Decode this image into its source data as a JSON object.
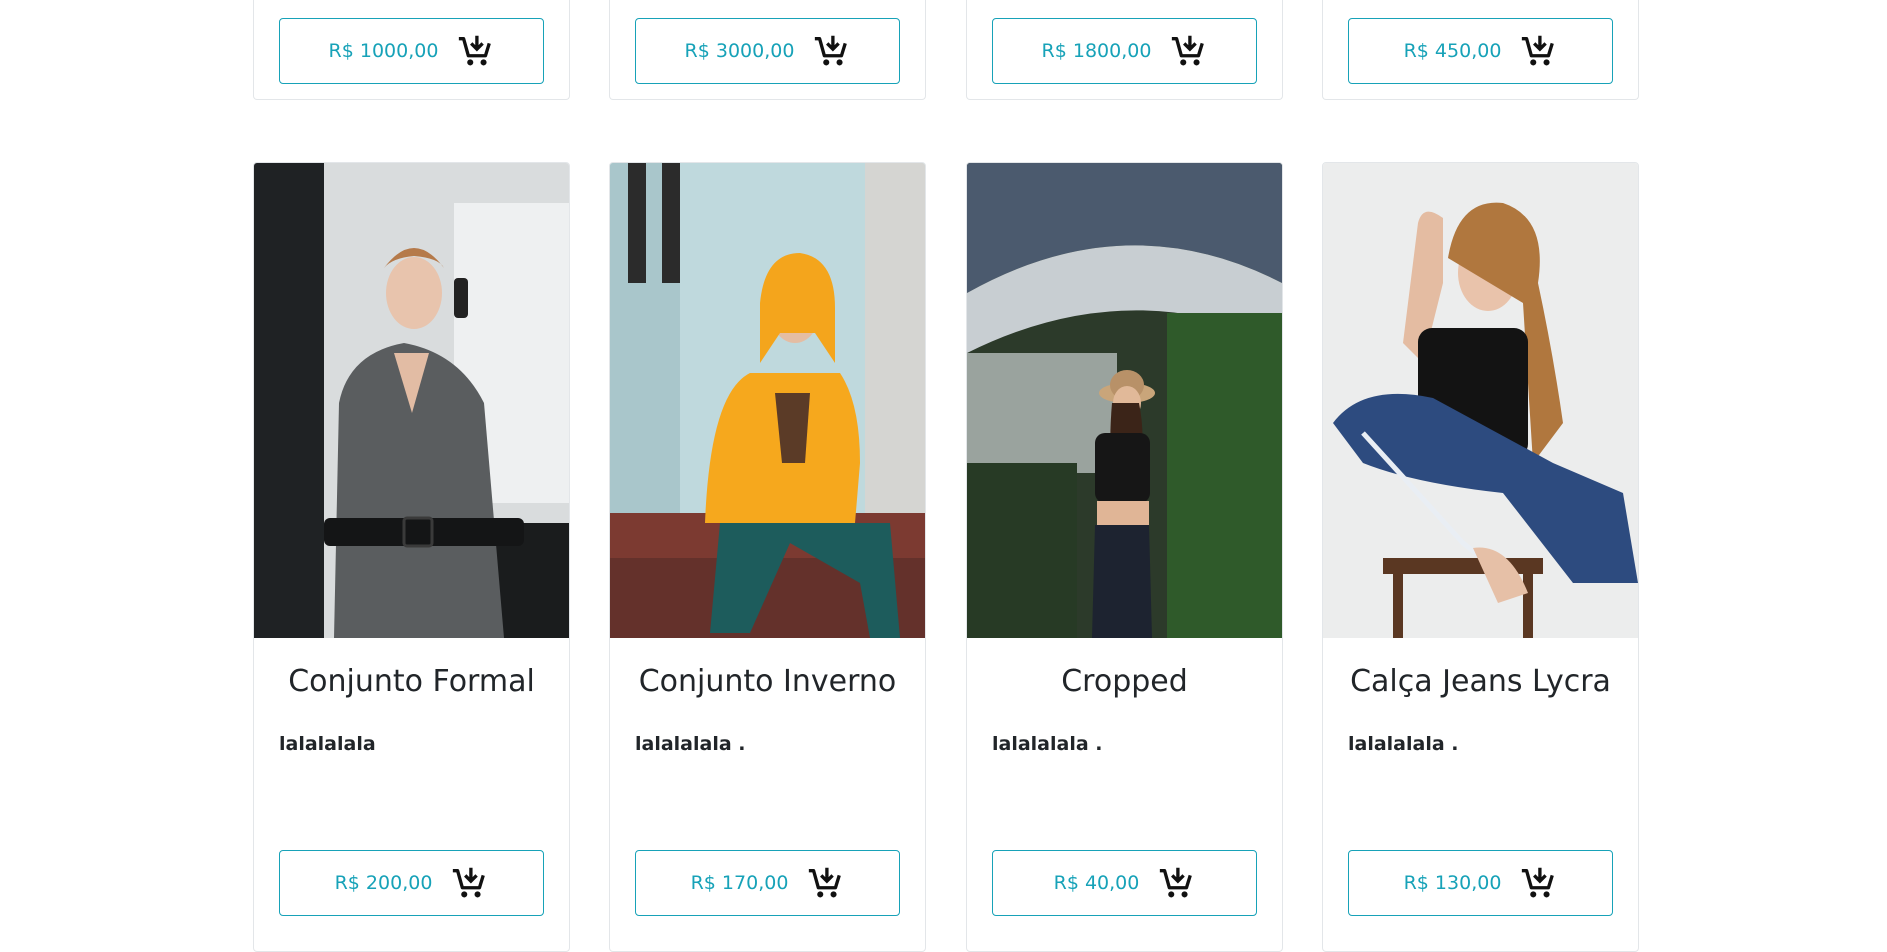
{
  "top_row": [
    {
      "price": "R$ 1000,00"
    },
    {
      "price": "R$ 3000,00"
    },
    {
      "price": "R$ 1800,00"
    },
    {
      "price": "R$ 450,00"
    }
  ],
  "products": [
    {
      "name": "Conjunto Formal",
      "description": "lalalalala",
      "price": "R$ 200,00",
      "image": "woman-gray-blazer-phone-photo"
    },
    {
      "name": "Conjunto Inverno",
      "description": "lalalalala .",
      "price": "R$ 170,00",
      "image": "woman-yellow-hoodie-photo"
    },
    {
      "name": "Cropped",
      "description": "lalalalala .",
      "price": "R$ 40,00",
      "image": "woman-greenhouse-hat-photo"
    },
    {
      "name": "Calça Jeans Lycra",
      "description": "lalalalala .",
      "price": "R$ 130,00",
      "image": "woman-jeans-stool-photo"
    }
  ],
  "icons": {
    "cart": "add-to-cart-icon"
  },
  "colors": {
    "accent": "#17a2b8",
    "text": "#212529",
    "border": "#e3e6e9"
  }
}
